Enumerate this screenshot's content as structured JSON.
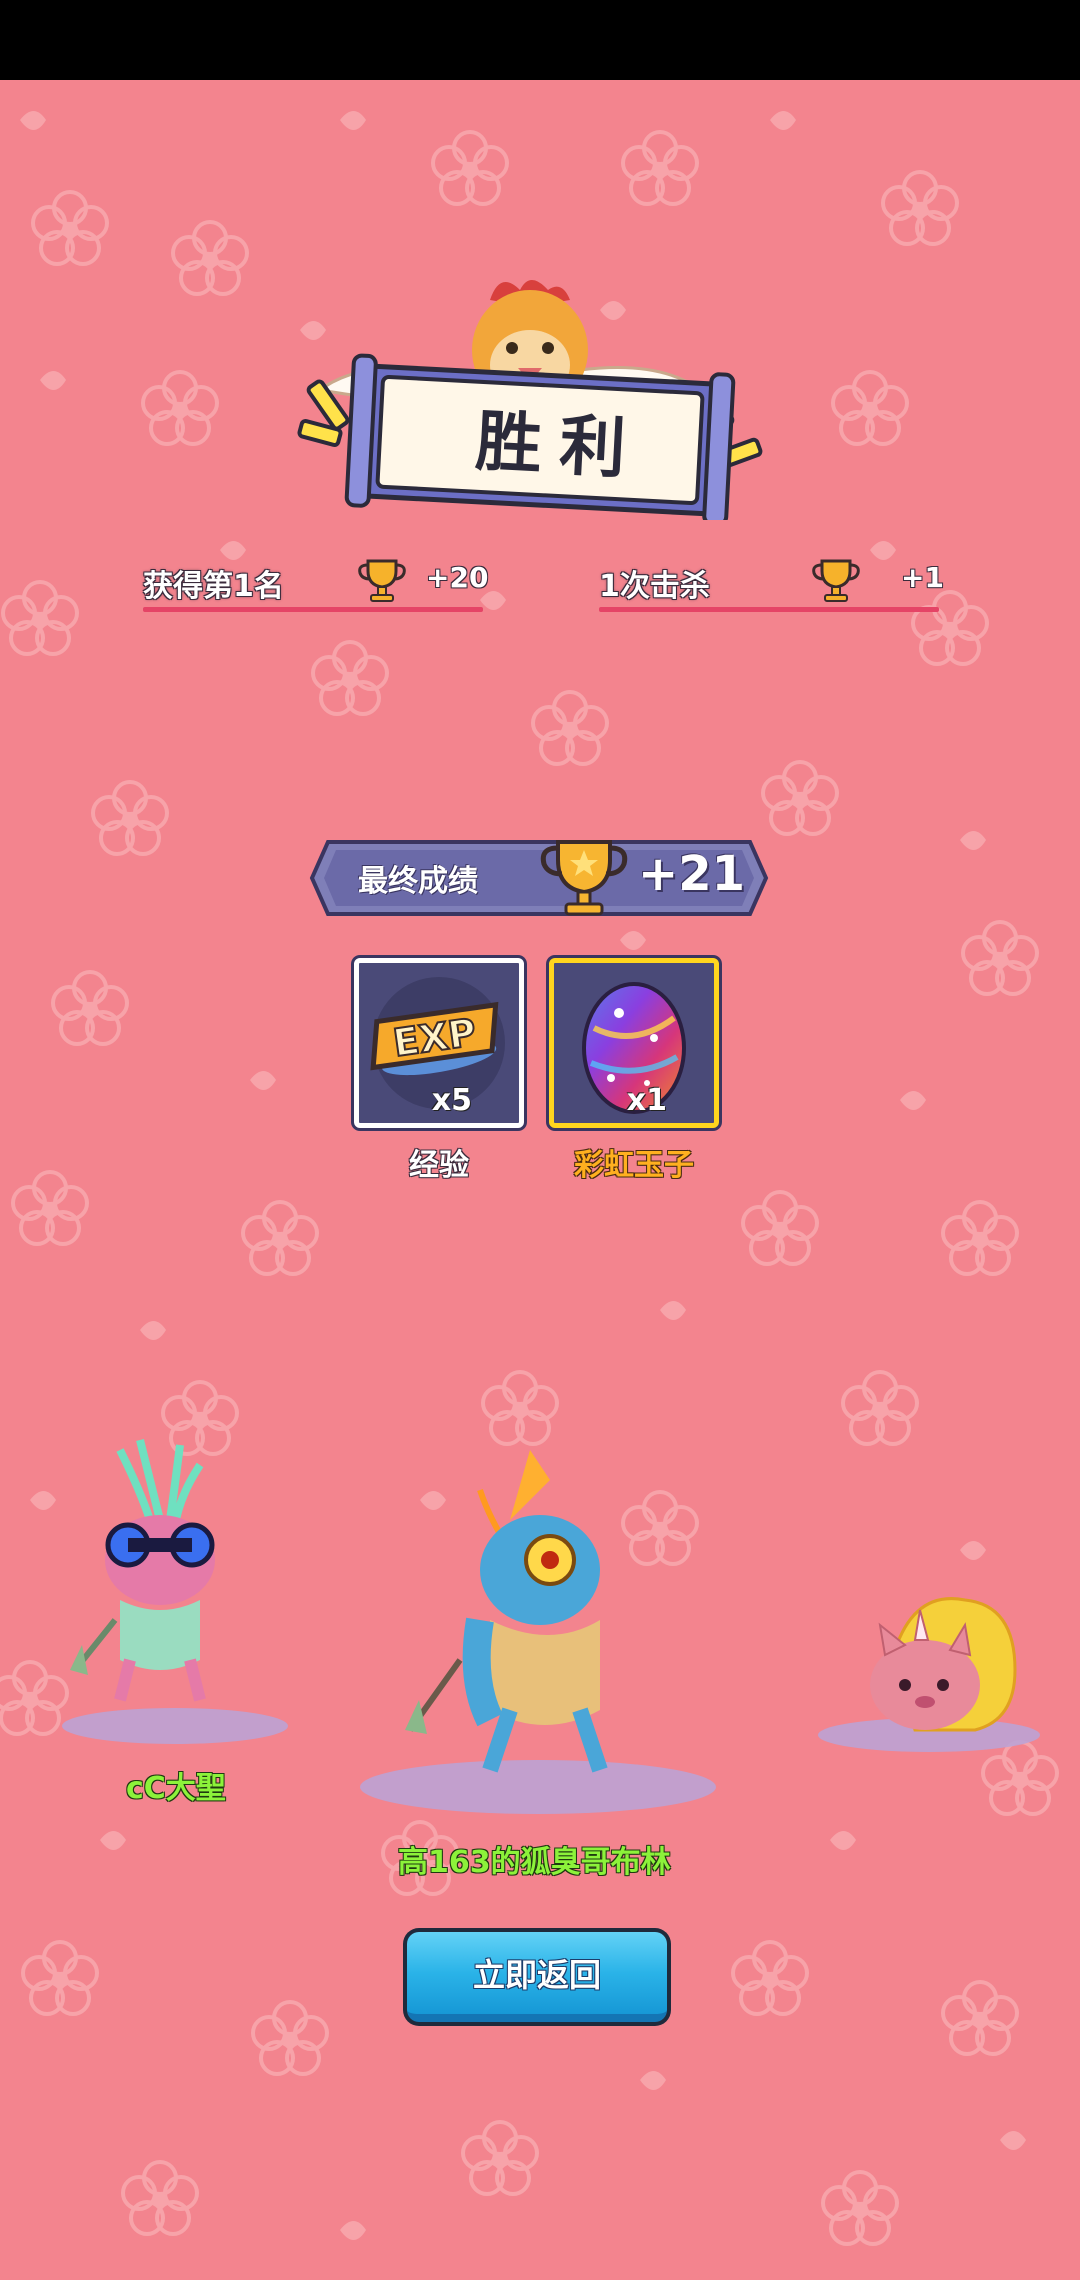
{
  "colors": {
    "background": "#f3848e",
    "banner_frame": "#6c6fc6",
    "banner_paper": "#fff7e8",
    "stat_line": "#e54466",
    "final_bar": "#7f7fb8",
    "pet_name": "#8cf23a",
    "return_button": "#2ab3e8"
  },
  "result_banner": {
    "title": "胜利",
    "mascot": "chicken-mascot-icon"
  },
  "stats": [
    {
      "label": "获得第1名",
      "icon": "trophy-icon",
      "value": "+20"
    },
    {
      "label": "1次击杀",
      "icon": "trophy-icon",
      "value": "+1"
    }
  ],
  "final_score": {
    "label": "最终成绩",
    "icon": "trophy-icon",
    "value": "+21"
  },
  "rewards": [
    {
      "icon": "exp-icon",
      "quantity": "x5",
      "name": "经验",
      "name_color": "#ffffff"
    },
    {
      "icon": "rainbow-egg-icon",
      "quantity": "x1",
      "name": "彩虹玉子",
      "name_color": "#ffb01f"
    }
  ],
  "pets": [
    {
      "player_name": "cC大聖",
      "pet": "pink-lizard-pet"
    },
    {
      "player_name": "高163的狐臭哥布林",
      "pet": "blue-lizard-pet"
    },
    {
      "player_name": "",
      "pet": "pink-hedgehog-pet"
    }
  ],
  "return_button": {
    "label": "立即返回"
  }
}
